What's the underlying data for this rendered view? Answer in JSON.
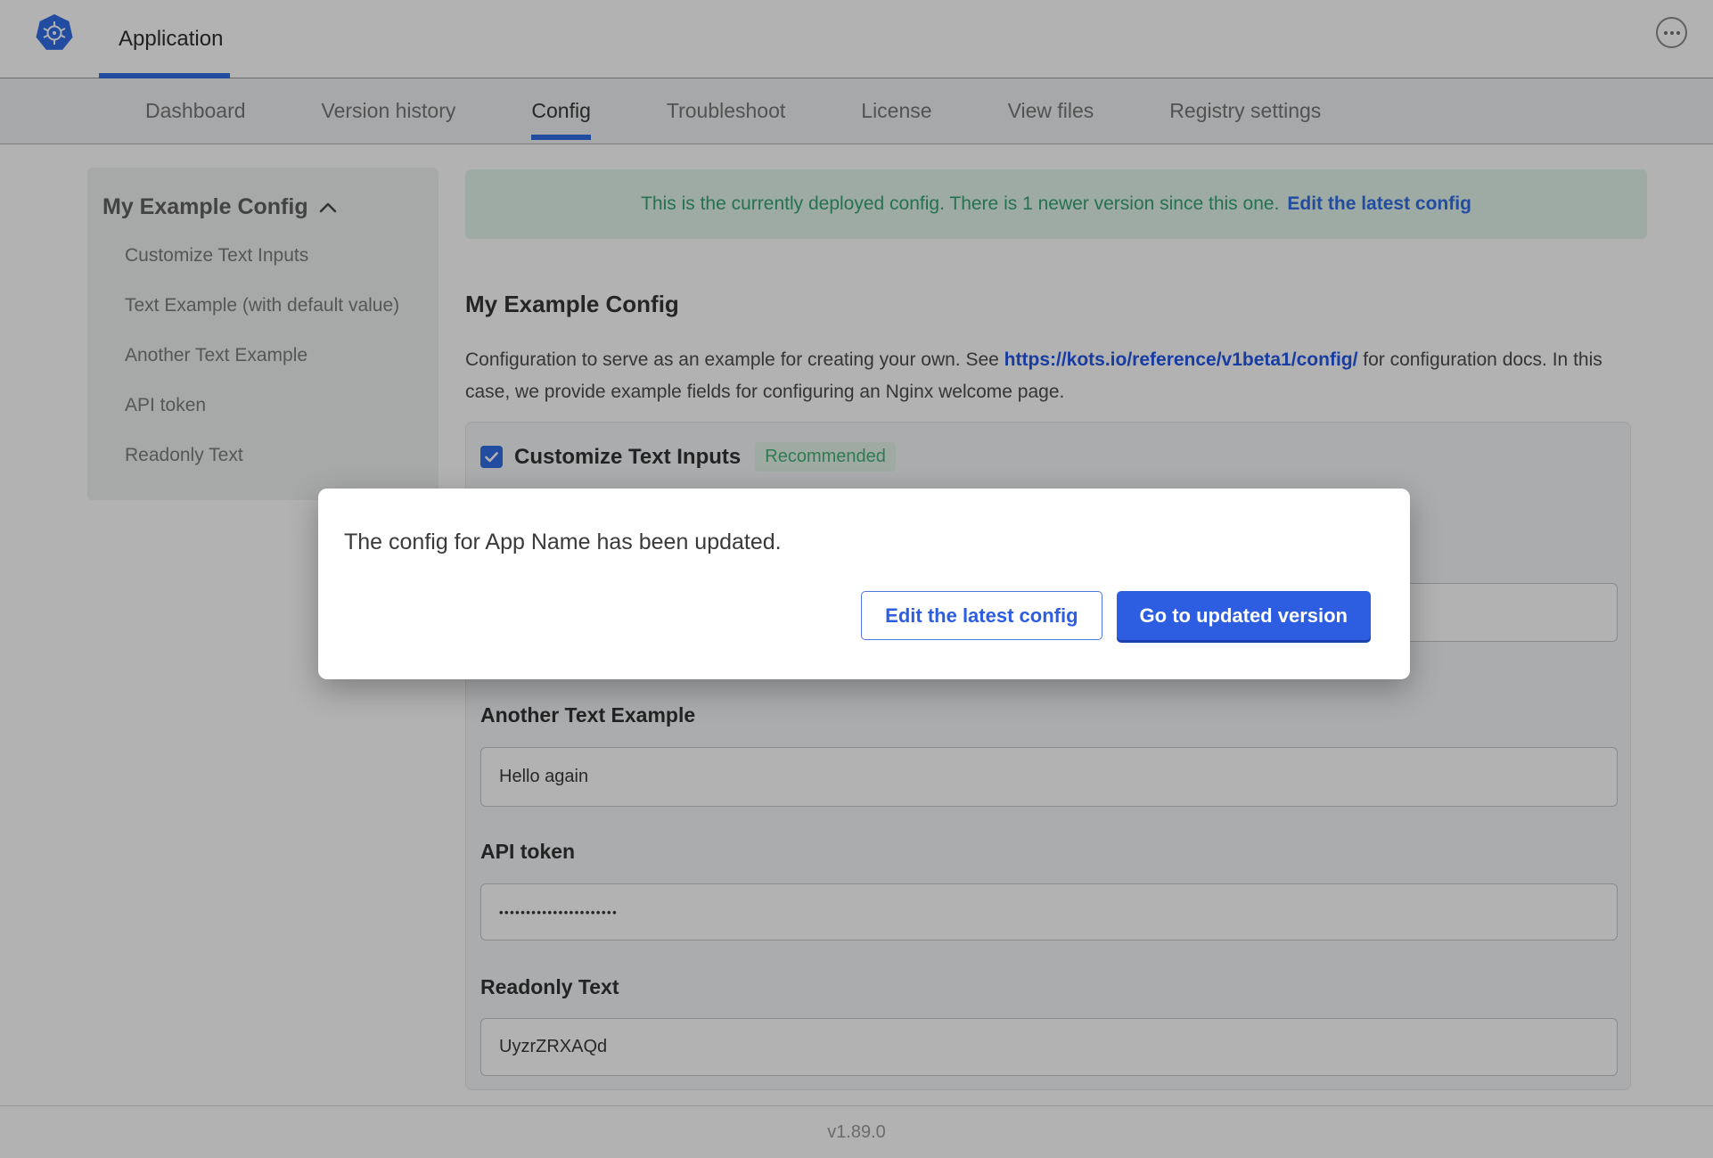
{
  "header": {
    "app_tab_label": "Application"
  },
  "nav": {
    "active": "Config",
    "items": [
      "Dashboard",
      "Version history",
      "Config",
      "Troubleshoot",
      "License",
      "View files",
      "Registry settings"
    ]
  },
  "sidebar": {
    "title": "My Example Config",
    "items": [
      "Customize Text Inputs",
      "Text Example (with default value)",
      "Another Text Example",
      "API token",
      "Readonly Text"
    ]
  },
  "banner": {
    "message": "This is the currently deployed config. There is 1 newer version since this one.",
    "link_label": "Edit the latest config"
  },
  "main": {
    "title": "My Example Config",
    "description_before": "Configuration to serve as an example for creating your own. See ",
    "description_link": "https://kots.io/reference/v1beta1/config/",
    "description_after": " for configuration docs. In this case, we provide example fields for configuring an Nginx welcome page.",
    "group_checkbox_label": "Customize Text Inputs",
    "group_badge": "Recommended",
    "fields": {
      "another_text": {
        "label": "Another Text Example",
        "value": "Hello again"
      },
      "api_token": {
        "label": "API token",
        "value": "••••••••••••••••••••••"
      },
      "readonly": {
        "label": "Readonly Text",
        "value": "UyzrZRXAQd"
      }
    }
  },
  "modal": {
    "message": "The config for App Name has been updated.",
    "secondary_button_label": "Edit the latest config",
    "primary_button_label": "Go to updated version"
  },
  "footer": {
    "version": "v1.89.0"
  },
  "colors": {
    "accent_blue": "#326de6",
    "button_blue": "#2d5de0",
    "button_blue_shadow": "#1b43ad",
    "banner_green_text": "#35a276",
    "banner_green_bg": "#e2f5eb",
    "badge_green_text": "#44b077",
    "badge_green_bg": "#e4f4ea",
    "overlay": "rgba(0,0,0,0.30)"
  }
}
